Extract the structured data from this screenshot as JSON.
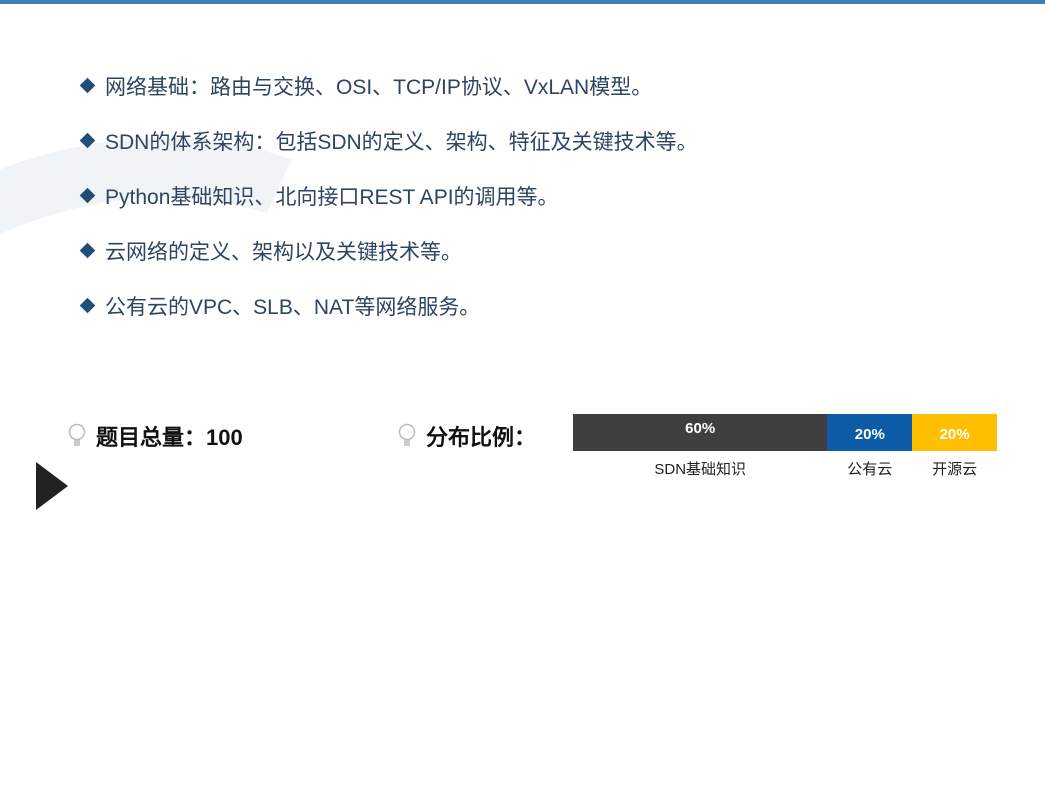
{
  "bullets": [
    "网络基础：路由与交换、OSI、TCP/IP协议、VxLAN模型。",
    "SDN的体系架构：包括SDN的定义、架构、特征及关键技术等。",
    "Python基础知识、北向接口REST API的调用等。",
    "云网络的定义、架构以及关键技术等。",
    "公有云的VPC、SLB、NAT等网络服务。"
  ],
  "total": {
    "label": "题目总量：100"
  },
  "distribution": {
    "label": "分布比例：",
    "segments": [
      {
        "name": "SDN基础知识",
        "value": 60,
        "text": "60%",
        "color": "#3f3f3f"
      },
      {
        "name": "公有云",
        "value": 20,
        "text": "20%",
        "color": "#0d5aa7"
      },
      {
        "name": "开源云",
        "value": 20,
        "text": "20%",
        "color": "#ffbe00"
      }
    ]
  }
}
